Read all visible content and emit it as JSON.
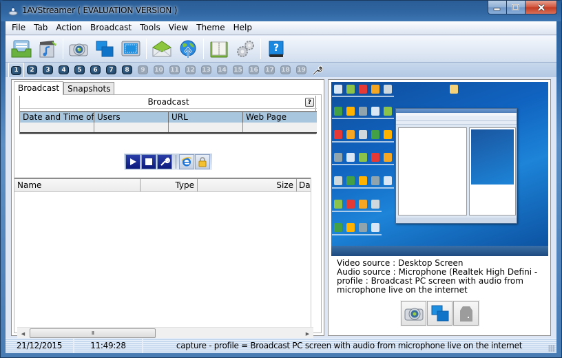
{
  "window": {
    "title": "1AVStreamer ( EVALUATION VERSION )",
    "controls": {
      "minimize": "minimize",
      "maximize": "maximize",
      "close": "close"
    }
  },
  "menu": [
    "File",
    "Tab",
    "Action",
    "Broadcast",
    "Tools",
    "View",
    "Theme",
    "Help"
  ],
  "toolbar": {
    "groups": [
      [
        {
          "name": "inbox-tray-icon",
          "tooltip": ""
        },
        {
          "name": "media-clapper-icon",
          "tooltip": ""
        }
      ],
      [
        {
          "name": "webcam-icon"
        },
        {
          "name": "windows-icon"
        },
        {
          "name": "screen-region-icon"
        }
      ],
      [
        {
          "name": "envelope-icon"
        },
        {
          "name": "globe-upload-icon"
        }
      ],
      [
        {
          "name": "book-icon"
        },
        {
          "name": "gears-icon"
        }
      ],
      [
        {
          "name": "help-book-icon"
        }
      ]
    ]
  },
  "channel_tabs": {
    "items": [
      "1",
      "2",
      "3",
      "4",
      "5",
      "6",
      "7",
      "8",
      "9",
      "10",
      "11",
      "12",
      "13",
      "14",
      "15",
      "16",
      "17",
      "18",
      "19"
    ],
    "active_count": 8,
    "selected": "1",
    "wrench_icon": "wrench-icon"
  },
  "left_panel": {
    "tabs": [
      {
        "label": "Broadcast",
        "active": true
      },
      {
        "label": "Snapshots",
        "active": false
      }
    ],
    "broadcast_header": "Broadcast",
    "help_label": "?",
    "broadcast_table": {
      "columns": [
        "Date and Time of",
        "Users",
        "URL",
        "Web Page"
      ],
      "rows": [
        [
          "",
          "",
          "",
          ""
        ]
      ]
    },
    "action_buttons": [
      "play-icon",
      "stop-icon",
      "settings-wrench-icon",
      "internet-explorer-icon",
      "lock-icon"
    ],
    "files_table": {
      "columns": [
        "Name",
        "Type",
        "Size",
        "Da"
      ],
      "rows": []
    },
    "scrollbar": {
      "left_arrow": "◀",
      "right_arrow": "▶",
      "grip": "III"
    }
  },
  "right_panel": {
    "preview_alt": "Desktop Screen preview",
    "video_source": "Video source : Desktop Screen",
    "audio_source": "Audio source : Microphone (Realtek High Defini -",
    "profile_line1": "profile : Broadcast PC screen with audio from",
    "profile_line2": "microphone live on the internet",
    "source_buttons": [
      "webcam-icon",
      "windows-icon",
      "disabled-device-icon"
    ]
  },
  "statusbar": {
    "date": "21/12/2015",
    "time": "11:49:28",
    "message": "capture - profile =  Broadcast PC screen with audio from microphone live on the internet"
  },
  "colors": {
    "titlebar": "#2c5f98",
    "header_blue": "#a9c6df",
    "close_red": "#c23a20",
    "accent_blue": "#1063c0"
  }
}
